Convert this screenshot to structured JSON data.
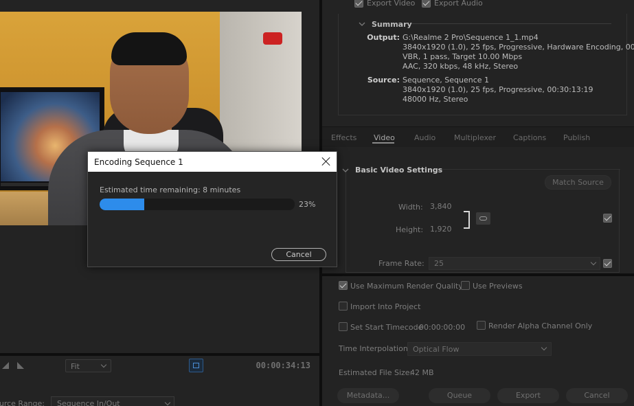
{
  "preview": {
    "fit_value": "Fit",
    "timecode": "00:00:34:13",
    "source_range_label": "Source Range:",
    "source_range_value": "Sequence In/Out"
  },
  "export_top": {
    "export_video_label": "Export Video",
    "export_audio_label": "Export Audio",
    "export_video_checked": true,
    "export_audio_checked": true
  },
  "summary": {
    "title": "Summary",
    "output_key": "Output:",
    "output_lines": [
      "G:\\Realme 2 Pro\\Sequence 1_1.mp4",
      "3840x1920 (1.0), 25 fps, Progressive, Hardware Encoding, 00...",
      "VBR, 1 pass, Target 10.00 Mbps",
      "AAC, 320 kbps, 48 kHz, Stereo"
    ],
    "source_key": "Source:",
    "source_lines": [
      "Sequence, Sequence 1",
      "3840x1920 (1.0), 25 fps, Progressive, 00:30:13:19",
      "48000 Hz, Stereo"
    ]
  },
  "tabs": [
    "Effects",
    "Video",
    "Audio",
    "Multiplexer",
    "Captions",
    "Publish"
  ],
  "active_tab": "Video",
  "video_settings": {
    "title": "Basic Video Settings",
    "match_source_label": "Match Source",
    "width_label": "Width:",
    "width_value": "3,840",
    "height_label": "Height:",
    "height_value": "1,920",
    "frame_rate_label": "Frame Rate:",
    "frame_rate_value": "25"
  },
  "options": {
    "max_render_quality_label": "Use Maximum Render Quality",
    "max_render_quality_checked": true,
    "use_previews_label": "Use Previews",
    "use_previews_checked": false,
    "import_into_project_label": "Import Into Project",
    "import_into_project_checked": false,
    "set_start_timecode_label": "Set Start Timecode",
    "set_start_timecode_value": "00:00:00:00",
    "set_start_timecode_checked": false,
    "render_alpha_label": "Render Alpha Channel Only",
    "render_alpha_checked": false,
    "time_interpolation_label": "Time Interpolation:",
    "time_interpolation_value": "Optical Flow",
    "estimated_size_label": "Estimated File Size:",
    "estimated_size_value": "42 MB"
  },
  "buttons": {
    "metadata": "Metadata...",
    "queue": "Queue",
    "export": "Export",
    "cancel": "Cancel"
  },
  "dialog": {
    "title": "Encoding Sequence 1",
    "eta_text": "Estimated time remaining: 8 minutes",
    "progress": 0.23,
    "progress_text": "23%",
    "cancel_label": "Cancel"
  },
  "colors": {
    "progress_fill": "#2d8ceb",
    "panel_bg": "#232323",
    "dialog_bg": "#252525"
  }
}
